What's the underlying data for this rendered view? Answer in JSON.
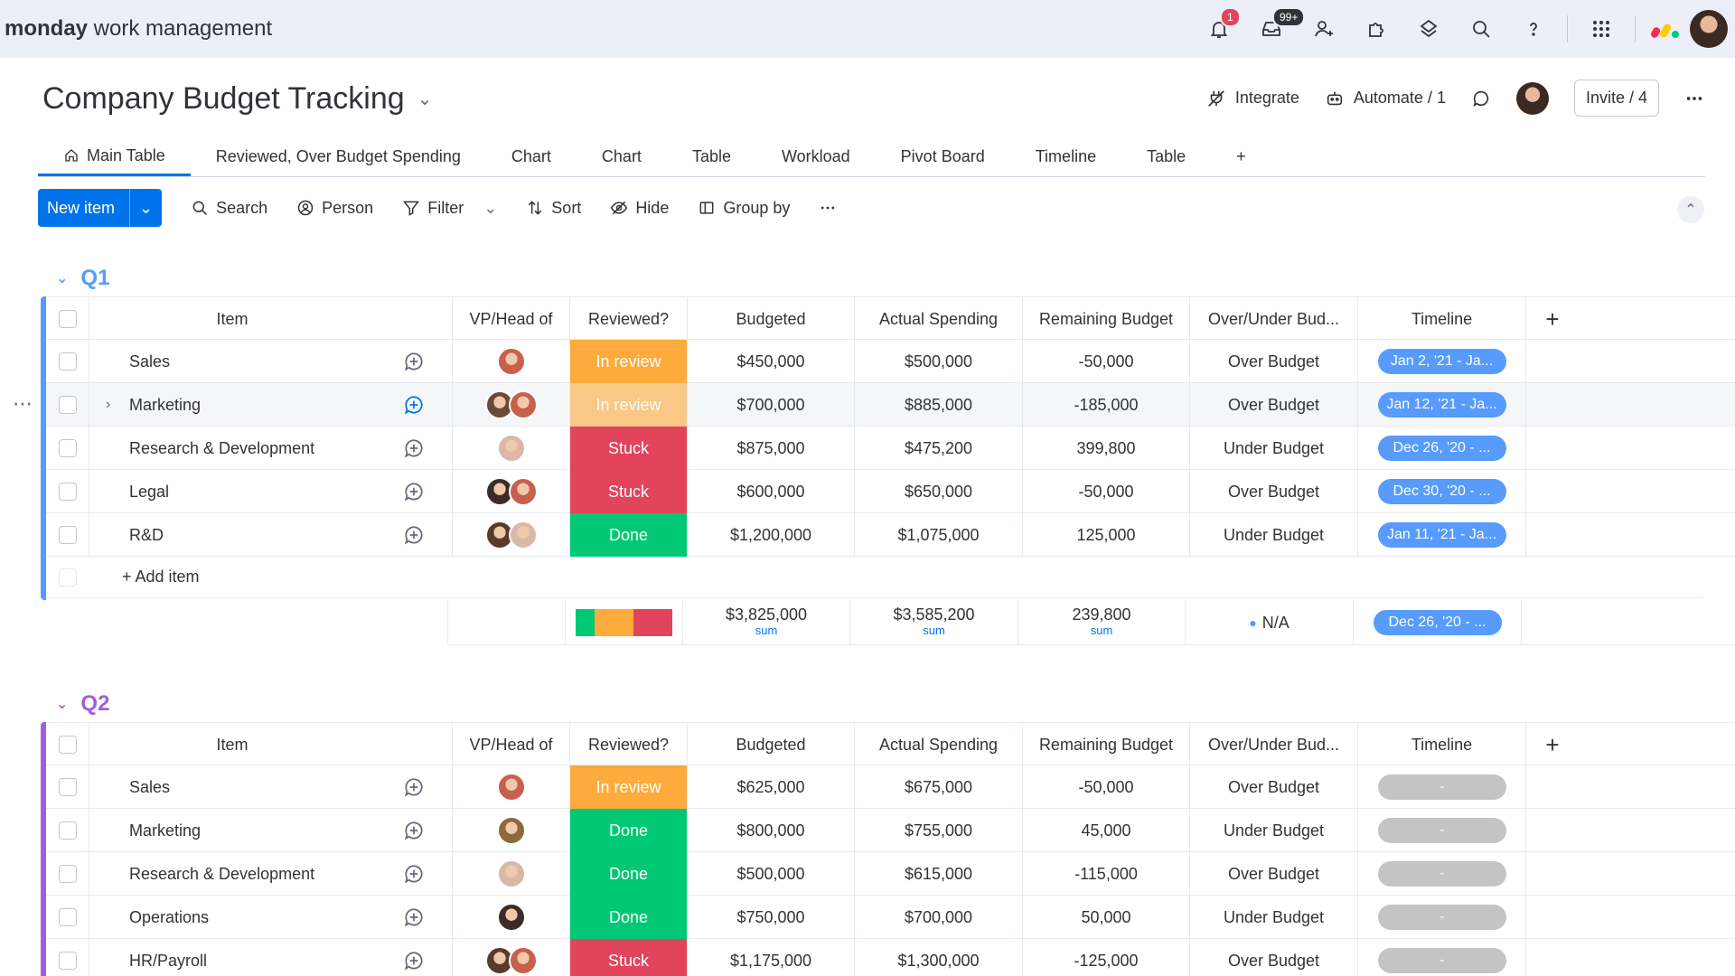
{
  "app": {
    "brand_bold": "monday",
    "brand_rest": " work management"
  },
  "topbar": {
    "notifications_badge": "1",
    "inbox_badge": "99+"
  },
  "board": {
    "title": "Company Budget Tracking",
    "integrate_label": "Integrate",
    "automate_label": "Automate / 1",
    "invite_label": "Invite / 4"
  },
  "tabs": [
    "Main Table",
    "Reviewed, Over Budget Spending",
    "Chart",
    "Chart",
    "Table",
    "Workload",
    "Pivot Board",
    "Timeline",
    "Table",
    "+"
  ],
  "toolbar": {
    "new_item": "New item",
    "search": "Search",
    "person": "Person",
    "filter": "Filter",
    "sort": "Sort",
    "hide": "Hide",
    "group_by": "Group by"
  },
  "columns": {
    "item": "Item",
    "vp": "VP/Head of",
    "reviewed": "Reviewed?",
    "budgeted": "Budgeted",
    "actual": "Actual Spending",
    "remaining": "Remaining Budget",
    "over_under": "Over/Under Bud...",
    "timeline": "Timeline",
    "add": "+"
  },
  "colors": {
    "accent": "#0073ea",
    "in_review": "#fdab3d",
    "stuck": "#e2445c",
    "done": "#00c875",
    "q1": "#579bfc",
    "q2": "#a25ddc"
  },
  "groups": [
    {
      "title": "Q1",
      "color": "#579bfc",
      "rows": [
        {
          "item": "Sales",
          "vp": [
            "#c8604e"
          ],
          "status": "In review",
          "status_color": "#fdab3d",
          "budgeted": "$450,000",
          "actual": "$500,000",
          "remaining": "-50,000",
          "over_under": "Over Budget",
          "timeline": "Jan 2, '21 - Ja..."
        },
        {
          "item": "Marketing",
          "vp": [
            "#6b4a36",
            "#c8604e"
          ],
          "status": "In review",
          "status_color": "#fdab3d",
          "budgeted": "$700,000",
          "actual": "$885,000",
          "remaining": "-185,000",
          "over_under": "Over Budget",
          "timeline": "Jan 12, '21 - Ja..."
        },
        {
          "item": "Research & Development",
          "vp": [
            "#d9b8a8"
          ],
          "status": "Stuck",
          "status_color": "#e2445c",
          "budgeted": "$875,000",
          "actual": "$475,200",
          "remaining": "399,800",
          "over_under": "Under Budget",
          "timeline": "Dec 26, '20 - ..."
        },
        {
          "item": "Legal",
          "vp": [
            "#3b2c2a",
            "#c8604e"
          ],
          "status": "Stuck",
          "status_color": "#e2445c",
          "budgeted": "$600,000",
          "actual": "$650,000",
          "remaining": "-50,000",
          "over_under": "Over Budget",
          "timeline": "Dec 30, '20 - ..."
        },
        {
          "item": "R&D",
          "vp": [
            "#5a3b2b",
            "#d9b8a8"
          ],
          "status": "Done",
          "status_color": "#00c875",
          "budgeted": "$1,200,000",
          "actual": "$1,075,000",
          "remaining": "125,000",
          "over_under": "Under Budget",
          "timeline": "Jan 11, '21 - Ja..."
        }
      ],
      "add_item": "+ Add item",
      "summary": {
        "status_mix": [
          {
            "color": "#00c875",
            "fraction": 0.2
          },
          {
            "color": "#fdab3d",
            "fraction": 0.4
          },
          {
            "color": "#e2445c",
            "fraction": 0.4
          }
        ],
        "budgeted": "$3,825,000",
        "actual": "$3,585,200",
        "remaining": "239,800",
        "sum_label": "sum",
        "over_under": "N/A",
        "timeline": "Dec 26, '20 - ..."
      }
    },
    {
      "title": "Q2",
      "color": "#a25ddc",
      "rows": [
        {
          "item": "Sales",
          "vp": [
            "#c8604e"
          ],
          "status": "In review",
          "status_color": "#fdab3d",
          "budgeted": "$625,000",
          "actual": "$675,000",
          "remaining": "-50,000",
          "over_under": "Over Budget",
          "timeline": "-"
        },
        {
          "item": "Marketing",
          "vp": [
            "#8a6b3c"
          ],
          "status": "Done",
          "status_color": "#00c875",
          "budgeted": "$800,000",
          "actual": "$755,000",
          "remaining": "45,000",
          "over_under": "Under Budget",
          "timeline": "-"
        },
        {
          "item": "Research & Development",
          "vp": [
            "#d9b8a8"
          ],
          "status": "Done",
          "status_color": "#00c875",
          "budgeted": "$500,000",
          "actual": "$615,000",
          "remaining": "-115,000",
          "over_under": "Over Budget",
          "timeline": "-"
        },
        {
          "item": "Operations",
          "vp": [
            "#3b2c2a"
          ],
          "status": "Done",
          "status_color": "#00c875",
          "budgeted": "$750,000",
          "actual": "$700,000",
          "remaining": "50,000",
          "over_under": "Under Budget",
          "timeline": "-"
        },
        {
          "item": "HR/Payroll",
          "vp": [
            "#5a3b2b",
            "#c8604e"
          ],
          "status": "Stuck",
          "status_color": "#e2445c",
          "budgeted": "$1,175,000",
          "actual": "$1,300,000",
          "remaining": "-125,000",
          "over_under": "Over Budget",
          "timeline": "-"
        }
      ]
    }
  ]
}
